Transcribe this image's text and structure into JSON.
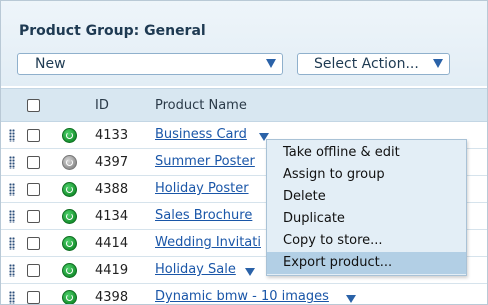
{
  "header": {
    "title": "Product Group: General"
  },
  "controls": {
    "new_select": {
      "selected": "New"
    },
    "action_select": {
      "selected": "Select Action..."
    }
  },
  "table": {
    "columns": {
      "id": "ID",
      "name": "Product Name"
    },
    "rows": [
      {
        "id": "4133",
        "name": "Business Card",
        "status": "online"
      },
      {
        "id": "4397",
        "name": "Summer Poster",
        "status": "offline"
      },
      {
        "id": "4388",
        "name": "Holiday Poster",
        "status": "online"
      },
      {
        "id": "4134",
        "name": "Sales Brochure",
        "status": "online"
      },
      {
        "id": "4414",
        "name": "Wedding Invitati",
        "status": "online"
      },
      {
        "id": "4419",
        "name": "Holiday Sale",
        "status": "online"
      },
      {
        "id": "4398",
        "name": "Dynamic bmw - 10 images",
        "status": "online"
      }
    ]
  },
  "context_menu": {
    "items": [
      "Take offline & edit",
      "Assign to group",
      "Delete",
      "Duplicate",
      "Copy to store...",
      "Export product..."
    ],
    "highlighted": "Export product..."
  },
  "colors": {
    "link": "#1a56a8",
    "header_bg": "#e2edf5",
    "online": "#17922f",
    "menu_highlight": "#b2cfe5"
  }
}
